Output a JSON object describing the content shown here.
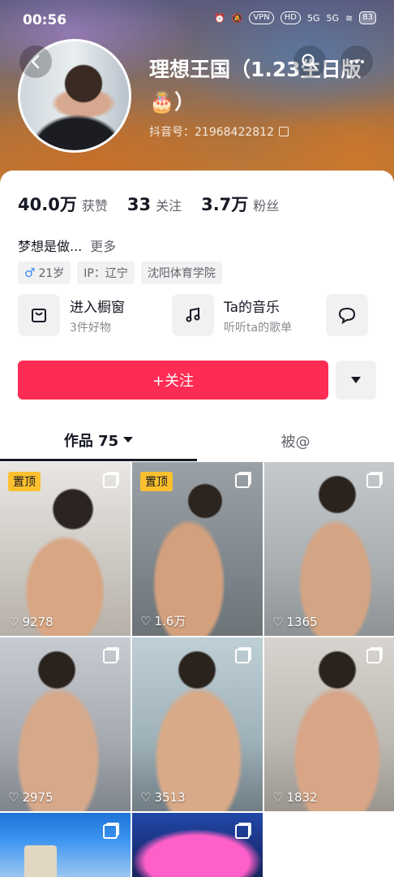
{
  "status_bar": {
    "time": "00:56",
    "vpn": "VPN",
    "hd": "HD",
    "signal1": "5G",
    "signal2": "5G",
    "battery": "83"
  },
  "profile": {
    "nickname": "理想王国（1.23生日版🎂）",
    "douyin_id": "抖音号：21968422812"
  },
  "stats": [
    {
      "value": "40.0万",
      "label": "获赞"
    },
    {
      "value": "33",
      "label": "关注"
    },
    {
      "value": "3.7万",
      "label": "粉丝"
    }
  ],
  "bio": {
    "text": "梦想是做...",
    "more": "更多"
  },
  "tags": {
    "gender_icon": "♂",
    "age": "21岁",
    "ip": "IP：辽宁",
    "school": "沈阳体育学院"
  },
  "entries": [
    {
      "icon": "shopping-bag-icon",
      "title": "进入橱窗",
      "subtitle": "3件好物"
    },
    {
      "icon": "music-note-icon",
      "title": "Ta的音乐",
      "subtitle": "听听ta的歌单"
    },
    {
      "icon": "chat-bubble-icon",
      "title": "",
      "subtitle": ""
    }
  ],
  "actions": {
    "follow_label": "+关注"
  },
  "tabs": [
    {
      "label": "作品 75"
    },
    {
      "label": "被@"
    }
  ],
  "videos": [
    {
      "pinned": "置顶",
      "likes": "9278"
    },
    {
      "pinned": "置顶",
      "likes": "1.6万"
    },
    {
      "pinned": "",
      "likes": "1365"
    },
    {
      "pinned": "",
      "likes": "2975"
    },
    {
      "pinned": "",
      "likes": "3513"
    },
    {
      "pinned": "",
      "likes": "1832"
    },
    {
      "pinned": "",
      "likes": ""
    },
    {
      "pinned": "",
      "likes": ""
    }
  ],
  "colors": {
    "accent": "#fe2c55",
    "pin_badge": "#fbc02d",
    "gender": "#3b87f5"
  }
}
